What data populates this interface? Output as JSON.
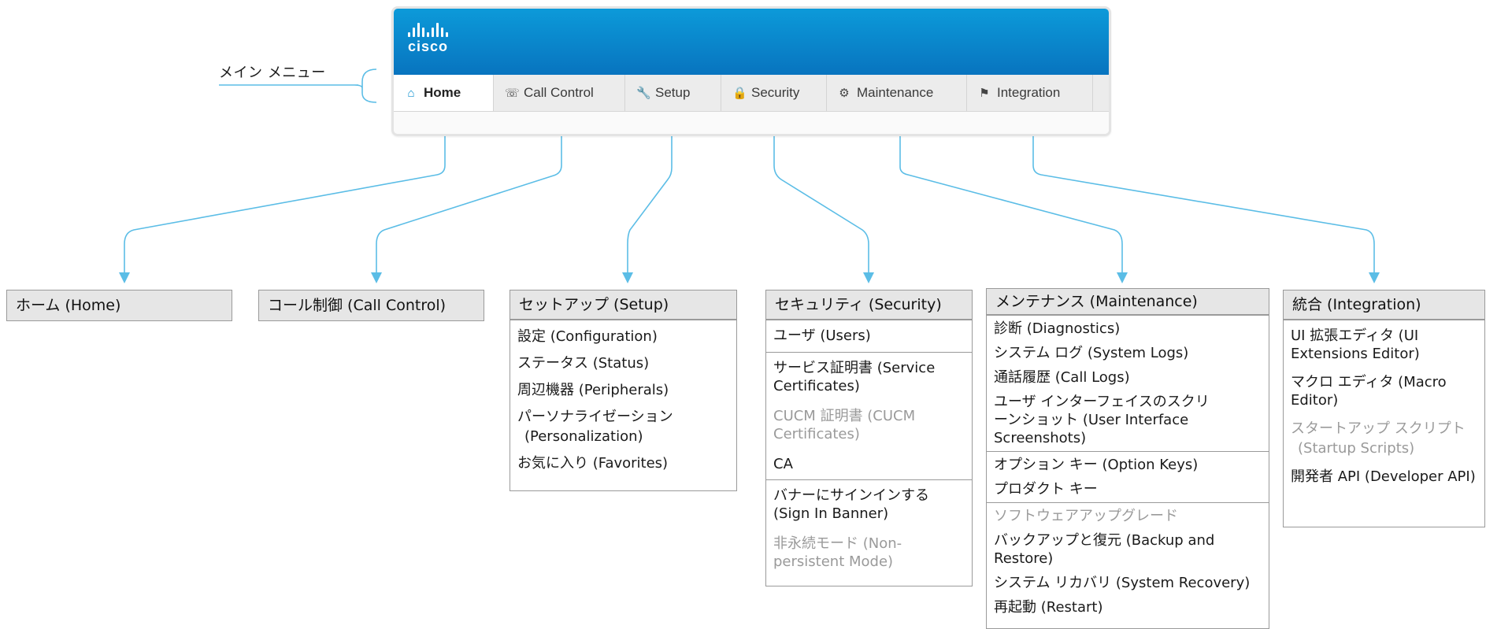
{
  "main_menu_label": "メイン メニュー",
  "logo_text": "cisco",
  "tabs": [
    {
      "label": "Home",
      "icon": "home-icon",
      "active": true
    },
    {
      "label": "Call Control",
      "icon": "phone-icon"
    },
    {
      "label": "Setup",
      "icon": "wrench-icon"
    },
    {
      "label": "Security",
      "icon": "lock-icon"
    },
    {
      "label": "Maintenance",
      "icon": "gear-icon"
    },
    {
      "label": "Integration",
      "icon": "integration-icon"
    }
  ],
  "boxes": {
    "home": {
      "title": "ホーム (Home)"
    },
    "call_control": {
      "title": "コール制御 (Call Control)"
    },
    "setup": {
      "title": "セットアップ (Setup)",
      "items": [
        "設定 (Configuration)",
        "ステータス (Status)",
        "周辺機器 (Peripherals)",
        "パーソナライゼーション",
        "(Personalization)",
        "お気に入り (Favorites)"
      ]
    },
    "security": {
      "title": "セキュリティ (Security)",
      "items": [
        "ユーザ (Users)",
        "サービス証明書 (Service Certificates)",
        "CUCM 証明書 (CUCM Certificates)",
        "CA",
        "バナーにサインインする (Sign In Banner)",
        "非永続モード (Non-persistent Mode)"
      ]
    },
    "maintenance": {
      "title": "メンテナンス (Maintenance)",
      "items": [
        "診断 (Diagnostics)",
        "システム ログ (System Logs)",
        "通話履歴 (Call Logs)",
        "ユーザ インターフェイスのスクリーンショット (User Interface Screenshots)",
        "オプション キー (Option Keys)",
        "プロダクト キー",
        "ソフトウェアアップグレード",
        "バックアップと復元 (Backup and Restore)",
        "システム リカバリ (System Recovery)",
        "再起動 (Restart)"
      ]
    },
    "integration": {
      "title": "統合 (Integration)",
      "items": [
        "UI 拡張エディタ (UI Extensions Editor)",
        "マクロ エディタ (Macro Editor)",
        "スタートアップ スクリプト",
        "(Startup Scripts)",
        "開発者 API (Developer API)"
      ]
    }
  },
  "colors": {
    "connector": "#5bbde6",
    "banner": "#0a86cc",
    "box_header": "#e6e6e6",
    "dim_text": "#9a9a9a"
  }
}
